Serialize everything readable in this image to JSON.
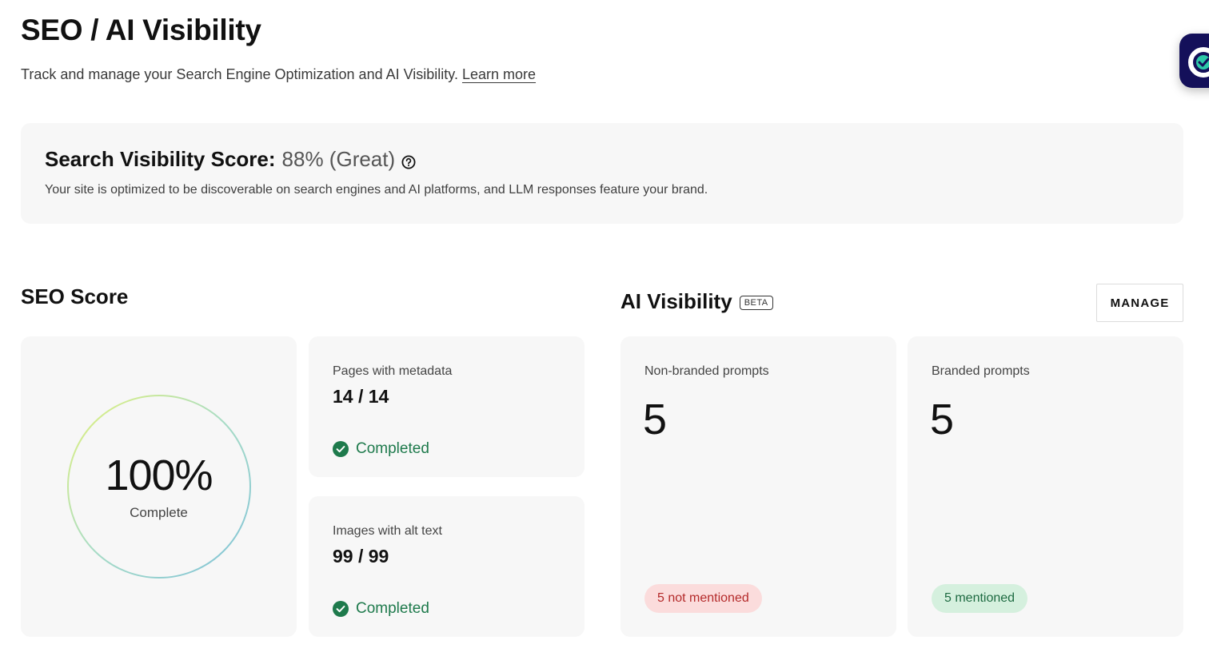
{
  "header": {
    "title": "SEO / AI Visibility",
    "subtitle": "Track and manage your Search Engine Optimization and AI Visibility.",
    "learn_more": "Learn more"
  },
  "visibility": {
    "label": "Search Visibility Score:",
    "value": "88% (Great)",
    "description": "Your site is optimized to be discoverable on search engines and AI platforms, and LLM responses feature your brand."
  },
  "seo": {
    "title": "SEO Score",
    "score": {
      "value": "100%",
      "label": "Complete",
      "progress": 1.0
    },
    "metadata": {
      "label": "Pages with metadata",
      "value": "14 / 14",
      "status": "Completed"
    },
    "alt_text": {
      "label": "Images with alt text",
      "value": "99 / 99",
      "status": "Completed"
    }
  },
  "ai": {
    "title": "AI Visibility",
    "badge": "BETA",
    "manage_label": "MANAGE",
    "non_branded": {
      "label": "Non-branded prompts",
      "count": "5",
      "status": "5 not mentioned"
    },
    "branded": {
      "label": "Branded prompts",
      "count": "5",
      "status": "5 mentioned"
    }
  },
  "icons": {
    "help": "help-circle-icon",
    "check": "check-circle-icon",
    "widget": "help-widget-icon"
  },
  "colors": {
    "success": "#1e7a4c",
    "danger_bg": "#fbdcdc",
    "danger_text": "#b42a2a",
    "success_bg": "#d5f0de",
    "card_bg": "#f7f7f7"
  }
}
